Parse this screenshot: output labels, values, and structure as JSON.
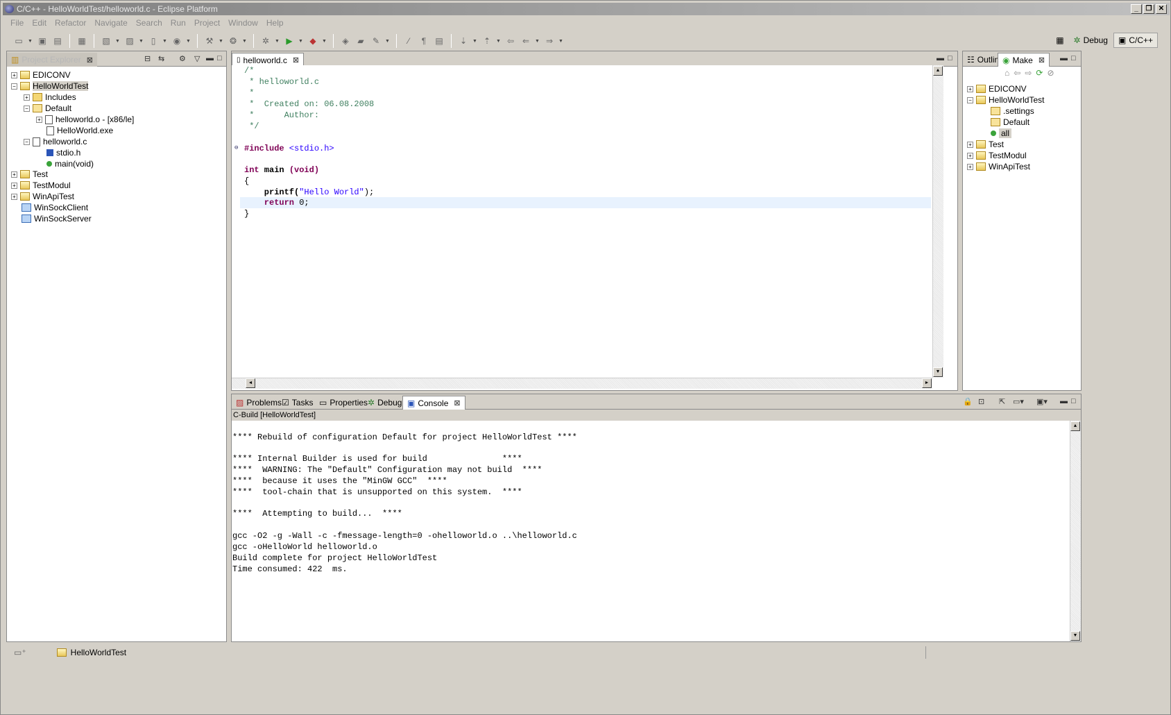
{
  "window": {
    "title": "C/C++ - HelloWorldTest/helloworld.c - Eclipse Platform",
    "controls": [
      "_",
      "❐",
      "✕"
    ]
  },
  "menu": [
    "File",
    "Edit",
    "Refactor",
    "Navigate",
    "Search",
    "Run",
    "Project",
    "Window",
    "Help"
  ],
  "perspectives": {
    "debug_label": "Debug",
    "cpp_label": "C/C++"
  },
  "project_explorer": {
    "title": "Project Explorer",
    "items": [
      {
        "label": "EDICONV",
        "expander": "+"
      },
      {
        "label": "HelloWorldTest",
        "expander": "−"
      },
      {
        "label": "Includes",
        "expander": "+"
      },
      {
        "label": "Default",
        "expander": "−"
      },
      {
        "label": "helloworld.o - [x86/le]",
        "expander": "+"
      },
      {
        "label": "HelloWorld.exe",
        "expander": ""
      },
      {
        "label": "helloworld.c",
        "expander": "−"
      },
      {
        "label": "stdio.h",
        "expander": ""
      },
      {
        "label": "main(void)",
        "expander": ""
      },
      {
        "label": "Test",
        "expander": "+"
      },
      {
        "label": "TestModul",
        "expander": "+"
      },
      {
        "label": "WinApiTest",
        "expander": "+"
      },
      {
        "label": "WinSockClient",
        "expander": ""
      },
      {
        "label": "WinSockServer",
        "expander": ""
      }
    ]
  },
  "editor": {
    "tab_label": "helloworld.c",
    "lines": {
      "l1": "/*",
      "l2": " * helloworld.c",
      "l3": " *",
      "l4": " *  Created on: 06.08.2008",
      "l5": " *      Author:",
      "l6": " */",
      "l7_kw": "#include",
      "l7_inc": " <stdio.h>",
      "l8_kw1": "int",
      "l8_mid": " main ",
      "l8_kw2": "(void)",
      "l9": "{",
      "l10_fn": "    printf(",
      "l10_str": "\"Hello World\"",
      "l10_end": ");",
      "l11_kw": "    return",
      "l11_end": " 0;",
      "l12": "}"
    }
  },
  "right_panel": {
    "outline_tab": "Outlin",
    "make_tab": "Make",
    "items": [
      {
        "label": "EDICONV",
        "expander": "+"
      },
      {
        "label": "HelloWorldTest",
        "expander": "−"
      },
      {
        "label": ".settings",
        "expander": ""
      },
      {
        "label": "Default",
        "expander": ""
      },
      {
        "label": "all",
        "expander": ""
      },
      {
        "label": "Test",
        "expander": "+"
      },
      {
        "label": "TestModul",
        "expander": "+"
      },
      {
        "label": "WinApiTest",
        "expander": "+"
      }
    ]
  },
  "bottom_tabs": {
    "problems": "Problems",
    "tasks": "Tasks",
    "properties": "Properties",
    "debug": "Debug",
    "console": "Console"
  },
  "console": {
    "header": "C-Build [HelloWorldTest]",
    "lines": [
      "**** Rebuild of configuration Default for project HelloWorldTest ****",
      "",
      "**** Internal Builder is used for build               ****",
      "****  WARNING: The \"Default\" Configuration may not build  ****",
      "****  because it uses the \"MinGW GCC\"  ****",
      "****  tool-chain that is unsupported on this system.  ****",
      "",
      "****  Attempting to build...  ****",
      "",
      "gcc -O2 -g -Wall -c -fmessage-length=0 -ohelloworld.o ..\\helloworld.c",
      "gcc -oHelloWorld helloworld.o",
      "Build complete for project HelloWorldTest",
      "Time consumed: 422  ms."
    ]
  },
  "status": {
    "project": "HelloWorldTest"
  }
}
